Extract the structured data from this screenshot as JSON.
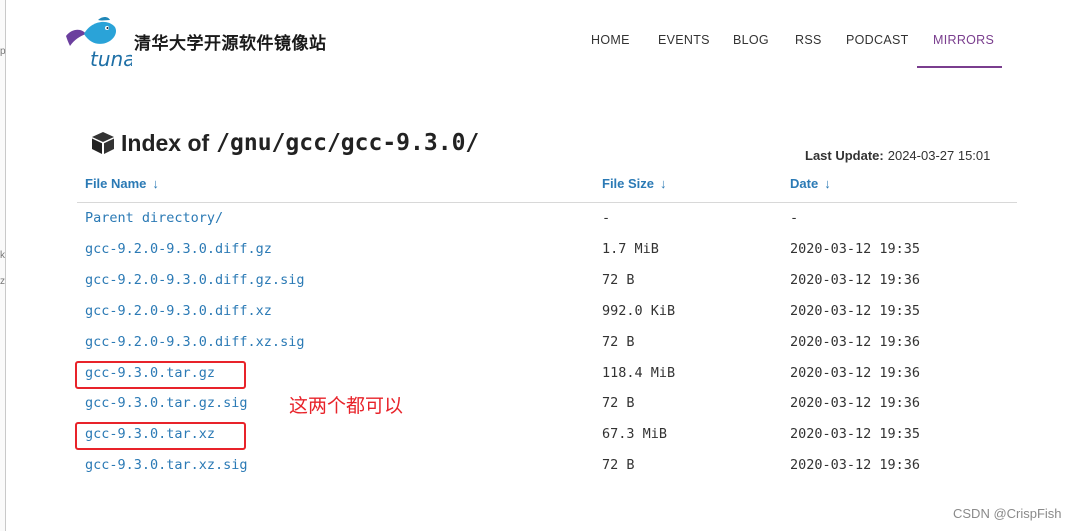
{
  "site": {
    "title": "清华大学开源软件镜像站",
    "logo_text": "tuna"
  },
  "nav": {
    "items": [
      {
        "label": "HOME",
        "active": false
      },
      {
        "label": "EVENTS",
        "active": false
      },
      {
        "label": "BLOG",
        "active": false
      },
      {
        "label": "RSS",
        "active": false
      },
      {
        "label": "PODCAST",
        "active": false
      },
      {
        "label": "MIRRORS",
        "active": true
      }
    ],
    "accent_color": "#7a3e8e"
  },
  "heading": {
    "icon": "box-icon",
    "label": "Index of",
    "path": "/gnu/gcc/gcc-9.3.0/"
  },
  "last_update": {
    "label": "Last Update:",
    "value": "2024-03-27 15:01"
  },
  "table": {
    "columns": [
      {
        "label": "File Name",
        "sort_icon": "↓"
      },
      {
        "label": "File Size",
        "sort_icon": "↓"
      },
      {
        "label": "Date",
        "sort_icon": "↓"
      }
    ],
    "rows": [
      {
        "name": "Parent directory/",
        "size": "-",
        "date": "-",
        "highlighted": false
      },
      {
        "name": "gcc-9.2.0-9.3.0.diff.gz",
        "size": "1.7 MiB",
        "date": "2020-03-12 19:35",
        "highlighted": false
      },
      {
        "name": "gcc-9.2.0-9.3.0.diff.gz.sig",
        "size": "72 B",
        "date": "2020-03-12 19:36",
        "highlighted": false
      },
      {
        "name": "gcc-9.2.0-9.3.0.diff.xz",
        "size": "992.0 KiB",
        "date": "2020-03-12 19:35",
        "highlighted": false
      },
      {
        "name": "gcc-9.2.0-9.3.0.diff.xz.sig",
        "size": "72 B",
        "date": "2020-03-12 19:36",
        "highlighted": false
      },
      {
        "name": "gcc-9.3.0.tar.gz",
        "size": "118.4 MiB",
        "date": "2020-03-12 19:36",
        "highlighted": true
      },
      {
        "name": "gcc-9.3.0.tar.gz.sig",
        "size": "72 B",
        "date": "2020-03-12 19:36",
        "highlighted": false
      },
      {
        "name": "gcc-9.3.0.tar.xz",
        "size": "67.3 MiB",
        "date": "2020-03-12 19:35",
        "highlighted": true
      },
      {
        "name": "gcc-9.3.0.tar.xz.sig",
        "size": "72 B",
        "date": "2020-03-12 19:36",
        "highlighted": false
      }
    ],
    "link_color": "#2b7ab5"
  },
  "annotation": {
    "text": "这两个都可以",
    "color": "#e8232a"
  },
  "watermark": {
    "text": "CSDN @CrispFish"
  }
}
